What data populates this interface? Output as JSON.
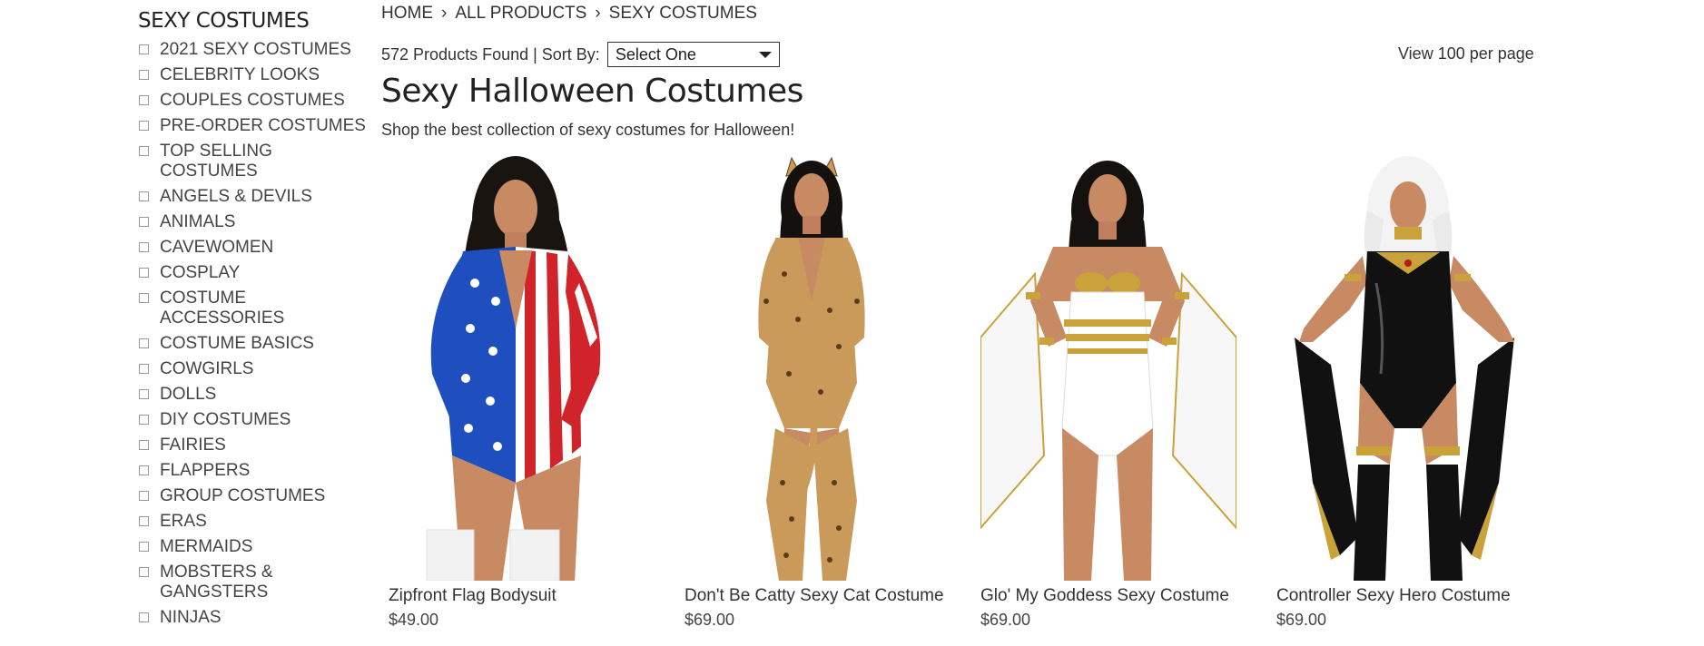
{
  "sidebar": {
    "title": "SEXY COSTUMES",
    "items": [
      {
        "label": "2021 SEXY COSTUMES"
      },
      {
        "label": "CELEBRITY LOOKS"
      },
      {
        "label": "COUPLES COSTUMES"
      },
      {
        "label": "PRE-ORDER COSTUMES"
      },
      {
        "label": "TOP SELLING COSTUMES"
      },
      {
        "label": "ANGELS & DEVILS"
      },
      {
        "label": "ANIMALS"
      },
      {
        "label": "CAVEWOMEN"
      },
      {
        "label": "COSPLAY"
      },
      {
        "label": "COSTUME ACCESSORIES"
      },
      {
        "label": "COSTUME BASICS"
      },
      {
        "label": "COWGIRLS"
      },
      {
        "label": "DOLLS"
      },
      {
        "label": "DIY COSTUMES"
      },
      {
        "label": "FAIRIES"
      },
      {
        "label": "FLAPPERS"
      },
      {
        "label": "GROUP COSTUMES"
      },
      {
        "label": "ERAS"
      },
      {
        "label": "MERMAIDS"
      },
      {
        "label": "MOBSTERS & GANGSTERS"
      },
      {
        "label": "NINJAS"
      }
    ]
  },
  "breadcrumb": {
    "items": [
      "HOME",
      "ALL PRODUCTS",
      "SEXY COSTUMES"
    ],
    "separator": "›"
  },
  "toolbar": {
    "results_text": "572 Products Found | Sort By:",
    "sort_value": "Select One",
    "per_page": "View 100 per page"
  },
  "page": {
    "title": "Sexy Halloween Costumes",
    "subtitle": "Shop the best collection of sexy costumes for Halloween!"
  },
  "products": [
    {
      "name": "Zipfront Flag Bodysuit",
      "price": "$49.00"
    },
    {
      "name": "Don't Be Catty Sexy Cat Costume",
      "price": "$69.00"
    },
    {
      "name": "Glo' My Goddess Sexy Costume",
      "price": "$69.00"
    },
    {
      "name": "Controller Sexy Hero Costume",
      "price": "$69.00"
    }
  ],
  "colors": {
    "flag_blue": "#1f4fbf",
    "flag_red": "#d0232a",
    "leopard": "#c99a5a",
    "gold": "#c9a23a",
    "latex_black": "#111111",
    "skin": "#c88a62"
  }
}
